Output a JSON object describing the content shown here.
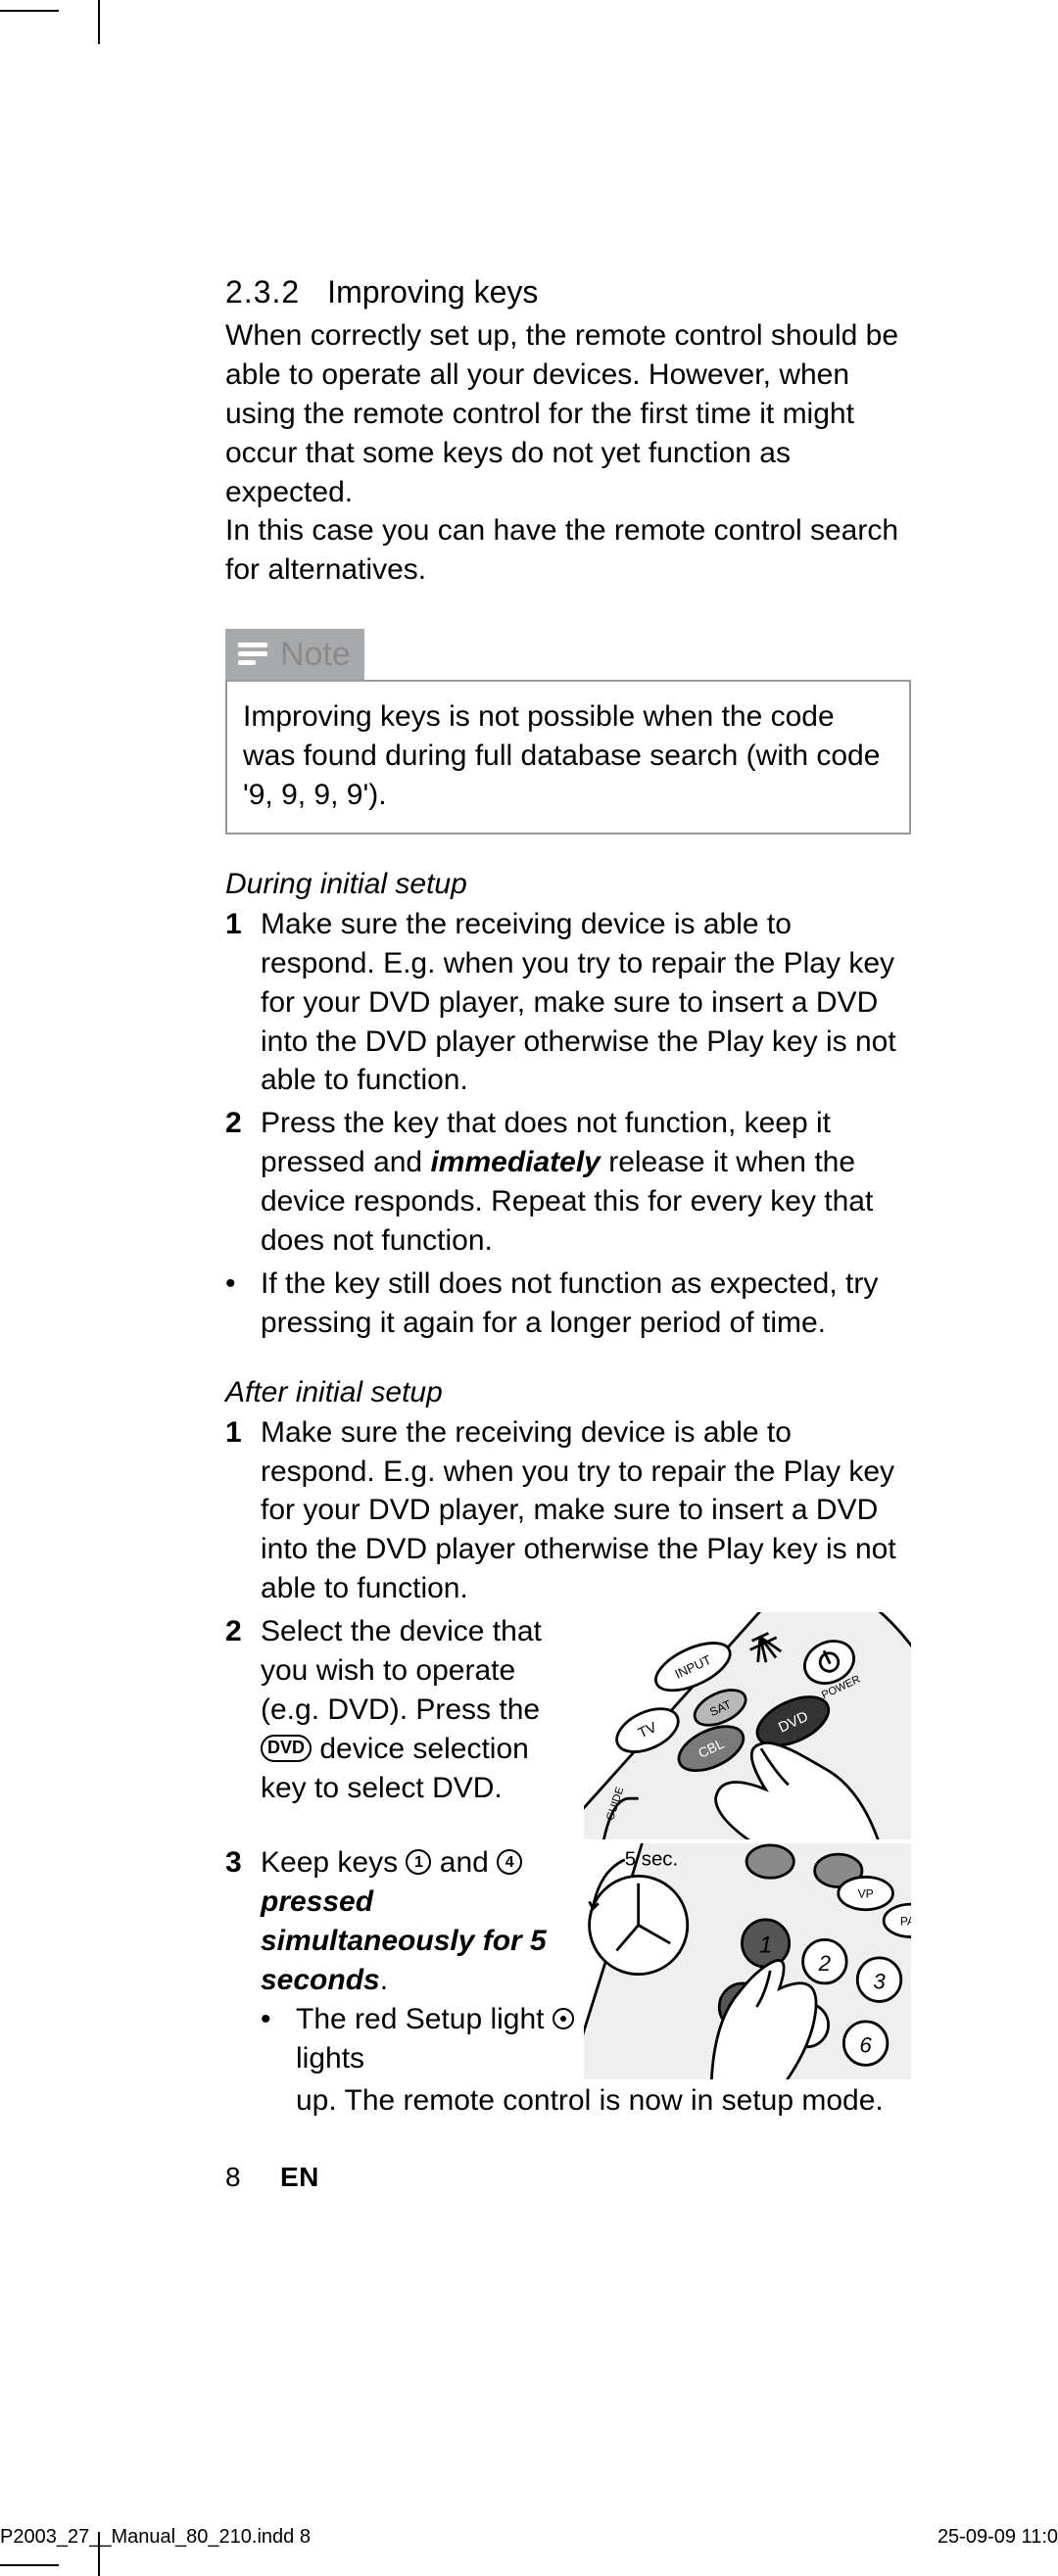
{
  "section": {
    "number": "2.3.2",
    "title": "Improving keys",
    "paragraph1": "When correctly set up, the remote control should be able to operate all your devices. However, when using the remote control for the first time it might occur that some keys do not yet function as expected.",
    "paragraph2": "In this case you can have the remote control search for alternatives."
  },
  "note": {
    "label": "Note",
    "text": "Improving keys is not possible when the code was found during full database search (with code '9, 9, 9, 9')."
  },
  "initial": {
    "heading": "During initial setup",
    "step1": "Make sure the receiving device is able to respond. E.g. when you try to repair the Play key for your DVD player, make sure to insert a DVD into the DVD player otherwise the Play key is not able to function.",
    "step2_a": "Press the key that does not function, keep it pressed and ",
    "step2_em": "immediately",
    "step2_b": " release it when the device responds. Repeat this for every key that does not function.",
    "bullet": "If the key still does not function as expected, try pressing it again for a longer period of time."
  },
  "after": {
    "heading": "After initial setup",
    "step1": "Make sure the receiving device is able to respond. E.g. when you try to repair the Play key for your DVD player, make sure to insert a DVD into the DVD player otherwise the Play key is not able to function.",
    "step2_a": "Select the device that you wish to operate (e.g. DVD). Press the ",
    "step2_pill": "DVD",
    "step2_b": " device selection key to select DVD.",
    "step3_a": "Keep keys ",
    "step3_b": " and ",
    "step3_em": " pressed simultaneously for 5 seconds",
    "step3_c": ".",
    "sub_a": "The red Setup light ",
    "sub_b": " lights up. The remote control is now in setup mode.",
    "illus1_labels": {
      "input": "INPUT",
      "power": "POWER",
      "tv": "TV",
      "sat": "SAT",
      "cbl": "CBL",
      "dvd": "DVD",
      "guide": "GUIDE"
    },
    "illus2_labels": {
      "sec": "5 sec.",
      "vp": "VP",
      "pa": "PA"
    }
  },
  "footer": {
    "page": "8",
    "lang": "EN"
  },
  "printmeta": {
    "left": "P2003_27__Manual_80_210.indd   8",
    "right": "25-09-09   11:0"
  }
}
